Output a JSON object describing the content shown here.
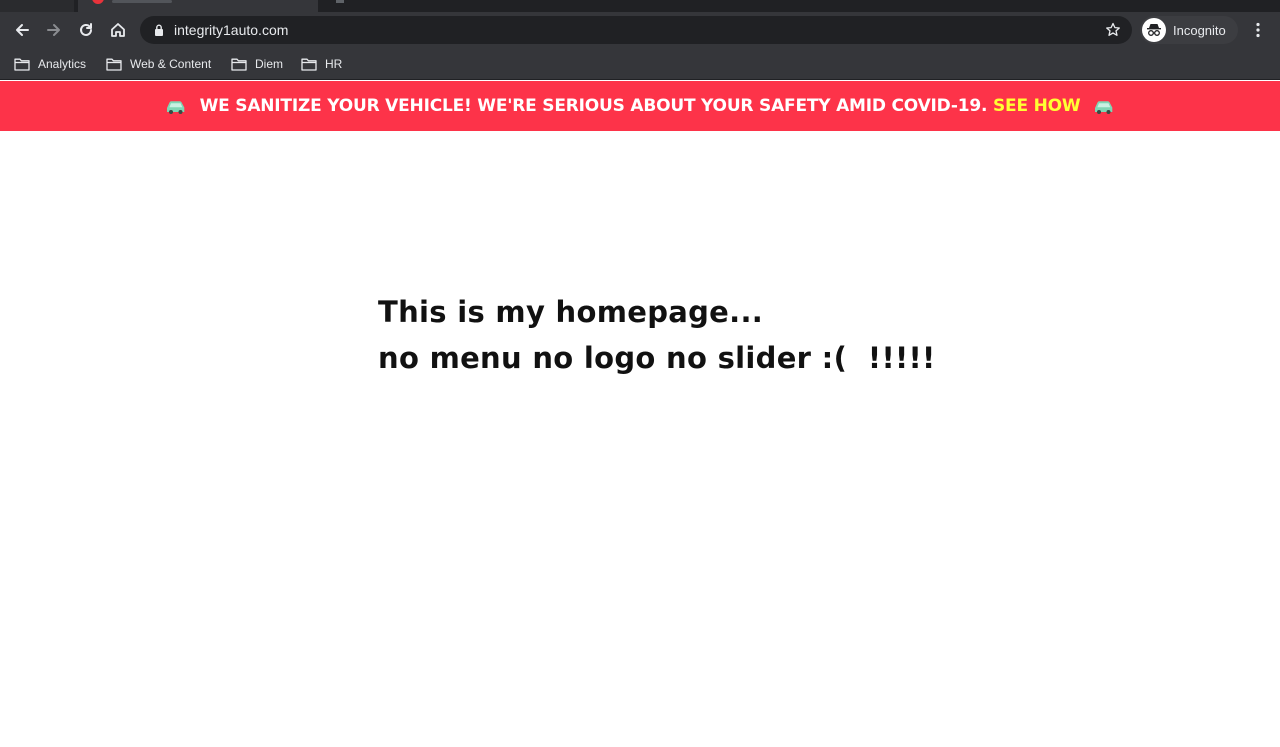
{
  "browser": {
    "url": "integrity1auto.com",
    "profile_label": "Incognito",
    "bookmarks": [
      "Analytics",
      "Web & Content",
      "Diem",
      "HR"
    ]
  },
  "banner": {
    "message": "WE SANITIZE YOUR VEHICLE! WE'RE SERIOUS ABOUT YOUR SAFETY AMID COVID-19.",
    "link": "SEE HOW",
    "background": "#fd3349",
    "link_color": "#ffff33"
  },
  "page": {
    "line1": "This is my homepage...",
    "line2": "no menu no logo no slider :(  !!!!!"
  }
}
